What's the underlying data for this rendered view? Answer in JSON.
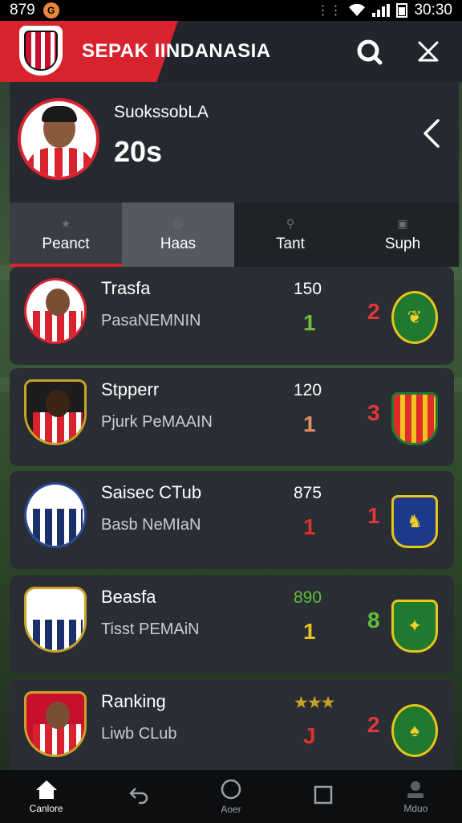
{
  "status_bar": {
    "time": "879",
    "clock": "30:30"
  },
  "header": {
    "title": "SEPAK IINDANASIA"
  },
  "profile": {
    "name": "SuokssobLA",
    "score": "20s"
  },
  "tabs": [
    {
      "label": "Peanct",
      "selected": true
    },
    {
      "label": "Haas",
      "selected": false
    },
    {
      "label": "Tant",
      "selected": false
    },
    {
      "label": "Suph",
      "selected": false
    }
  ],
  "rankings": [
    {
      "title": "Trasfa",
      "subtitle": "PasaNEMNIN",
      "points": "150",
      "rank": "1",
      "rank_color": "#6fbf3a",
      "position": "2"
    },
    {
      "title": "Stpperr",
      "subtitle": "Pjurk PeMAAIN",
      "points": "120",
      "rank": "1",
      "rank_color": "#e09060",
      "position": "3"
    },
    {
      "title": "Saisec CTub",
      "subtitle": "Basb NeMIaN",
      "points": "875",
      "rank": "1",
      "rank_color": "#d8332f",
      "position": "1"
    },
    {
      "title": "Beasfa",
      "subtitle": "Tisst PEMAiN",
      "points": "890",
      "points_color": "#5fbf3a",
      "rank": "1",
      "rank_color": "#e8c21f",
      "position": "8",
      "position_color": "#5fbf3a"
    },
    {
      "title": "Ranking",
      "subtitle": "Liwb CLub",
      "points": "★★★",
      "points_color": "#c9a227",
      "rank": "J",
      "rank_color": "#d8332f",
      "position": "2"
    }
  ],
  "nav": [
    {
      "label": "Canlore",
      "icon": "home-icon",
      "active": true
    },
    {
      "label": "",
      "icon": "back-icon",
      "active": false
    },
    {
      "label": "Aoer",
      "icon": "circle-icon",
      "active": false
    },
    {
      "label": "",
      "icon": "square-icon",
      "active": false
    },
    {
      "label": "Mduo",
      "icon": "profile-icon",
      "active": false
    }
  ],
  "colors": {
    "brand_red": "#d8232f",
    "header_bg": "#22262c",
    "card_bg": "#2a2d33"
  }
}
